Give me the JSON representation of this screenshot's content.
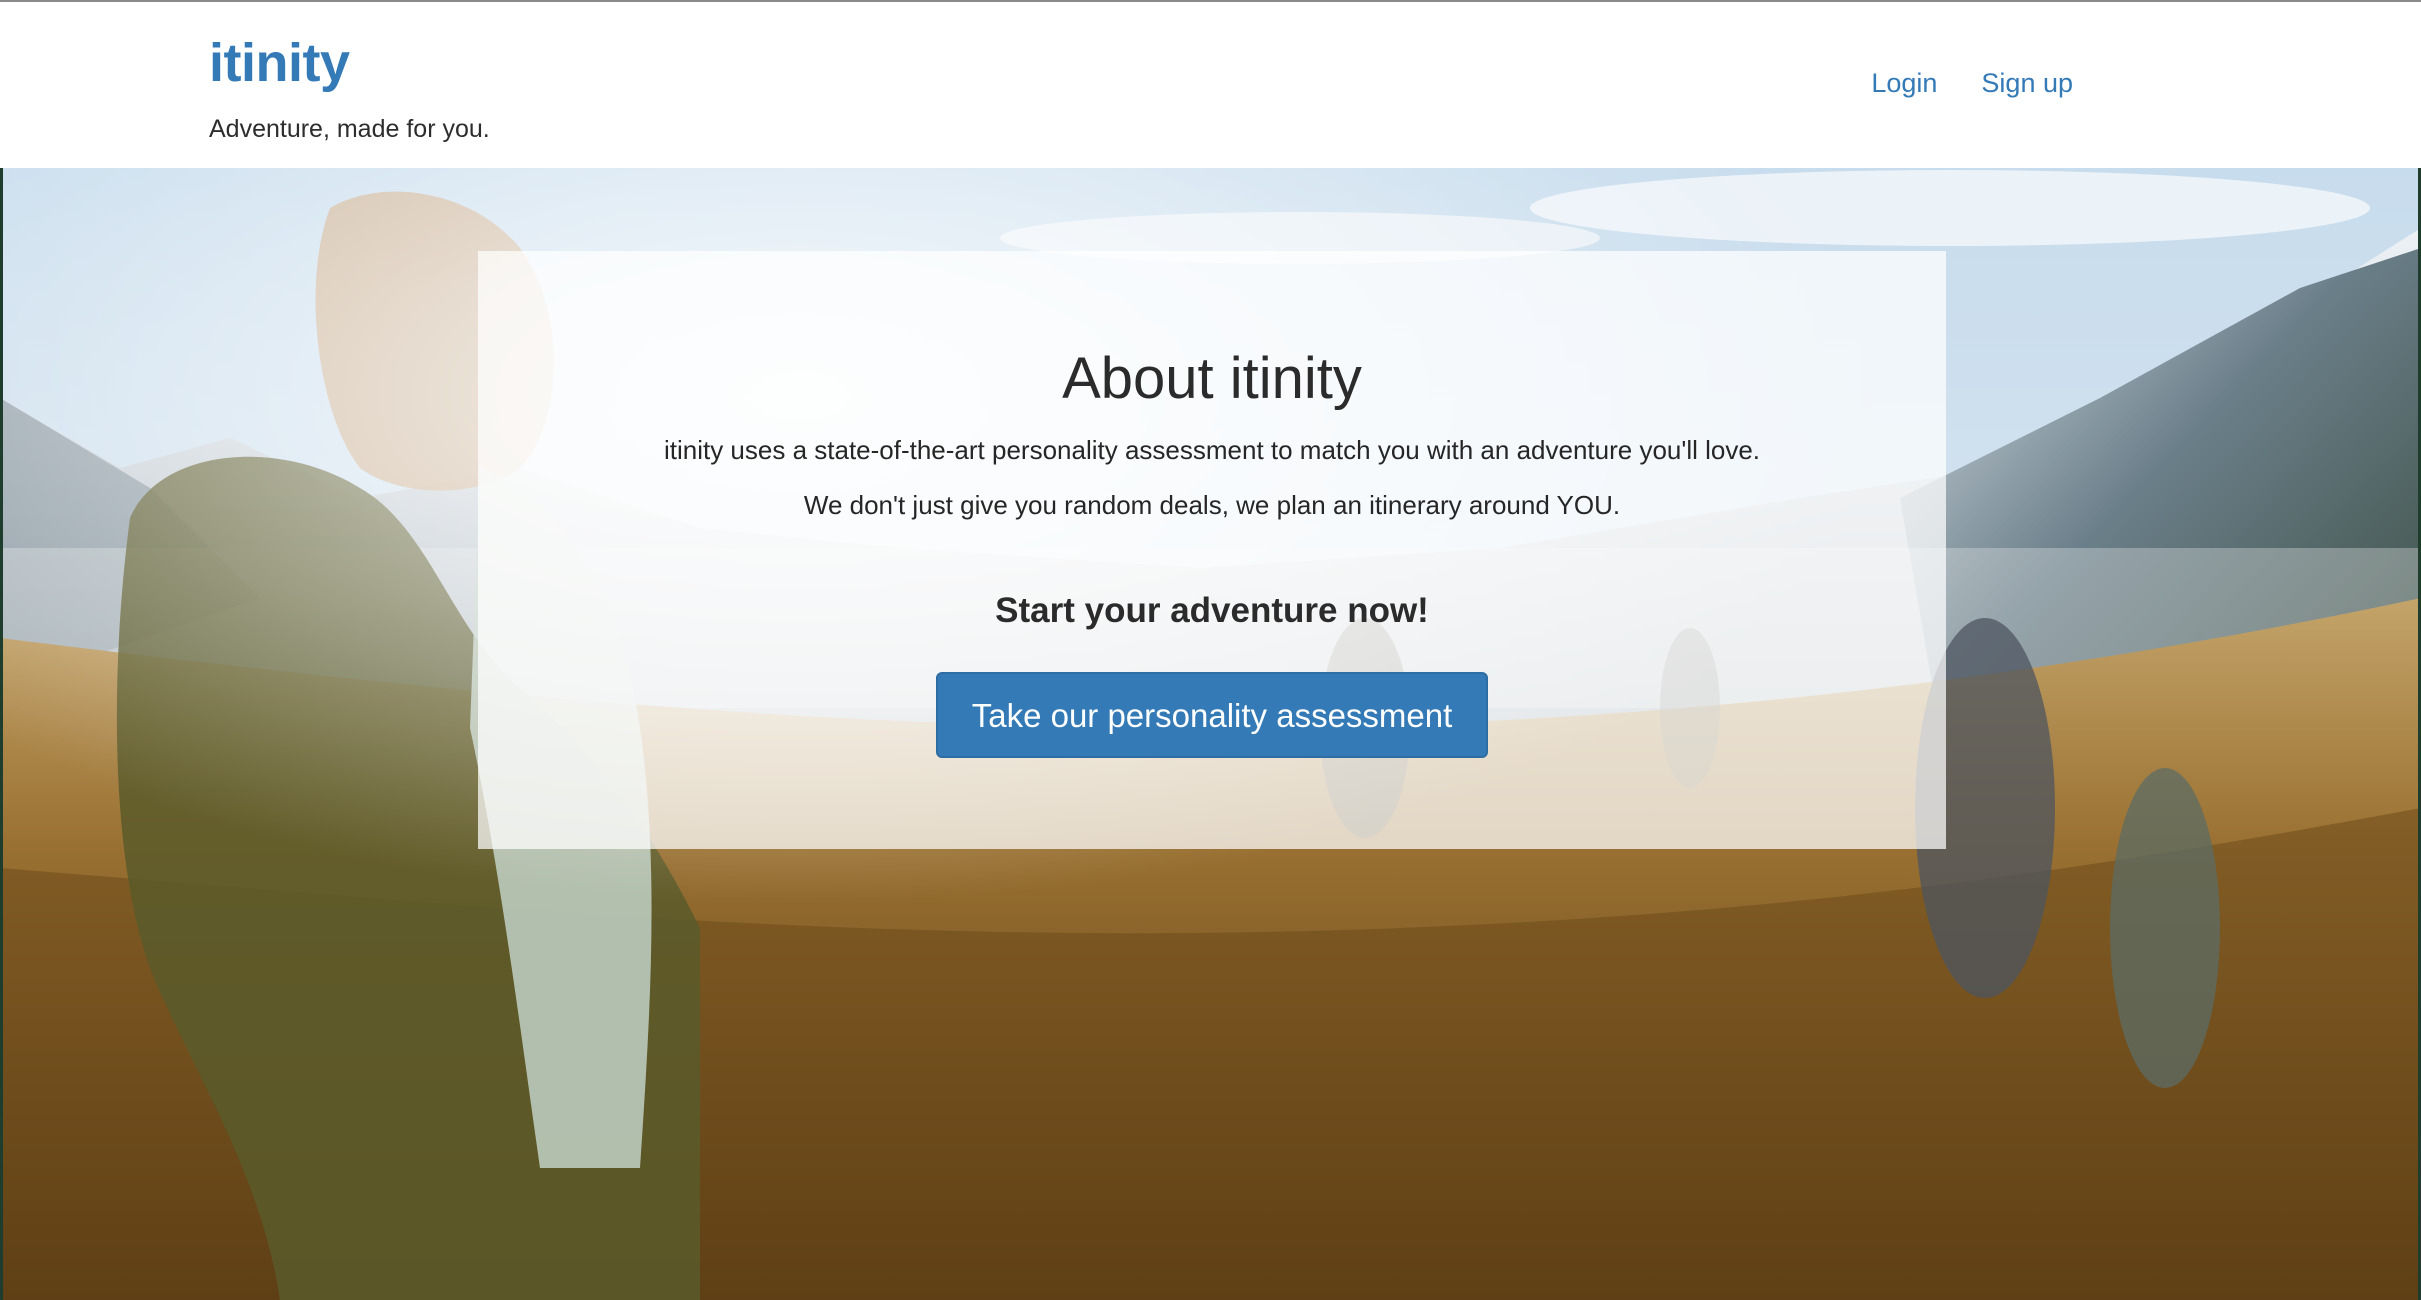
{
  "header": {
    "brand": "itinity",
    "tagline": "Adventure, made for you.",
    "nav": {
      "login": "Login",
      "signup": "Sign up"
    }
  },
  "about": {
    "title": "About itinity",
    "line1": "itinity uses a state-of-the-art personality assessment to match you with an adventure you'll love.",
    "line2": "We don't just give you random deals, we plan an itinerary around YOU.",
    "cta_heading": "Start your adventure now!",
    "cta_button": "Take our personality assessment"
  },
  "colors": {
    "accent": "#337ab7",
    "text": "#2b2b2b"
  }
}
